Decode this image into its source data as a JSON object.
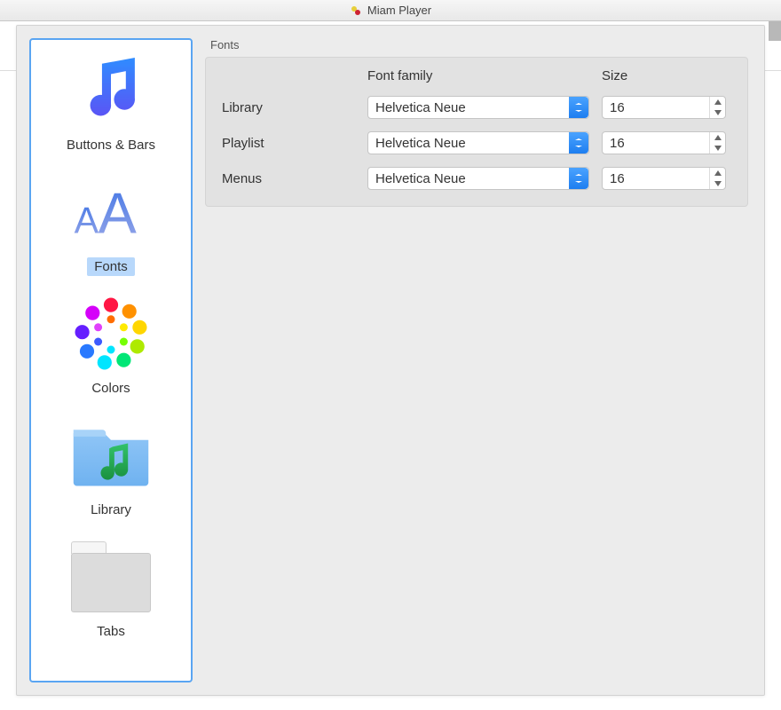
{
  "titlebar": {
    "title": "Miam Player"
  },
  "sidebar": {
    "items": [
      {
        "label": "Buttons & Bars",
        "icon": "music-note-icon"
      },
      {
        "label": "Fonts",
        "icon": "fonts-aa-icon"
      },
      {
        "label": "Colors",
        "icon": "color-wheel-icon"
      },
      {
        "label": "Library",
        "icon": "library-folder-icon"
      },
      {
        "label": "Tabs",
        "icon": "tabs-icon"
      }
    ],
    "selected_index": 1
  },
  "main": {
    "group_title": "Fonts",
    "columns": {
      "font_family": "Font family",
      "size": "Size"
    },
    "rows": [
      {
        "label": "Library",
        "font_family": "Helvetica Neue",
        "size": "16"
      },
      {
        "label": "Playlist",
        "font_family": "Helvetica Neue",
        "size": "16"
      },
      {
        "label": "Menus",
        "font_family": "Helvetica Neue",
        "size": "16"
      }
    ]
  }
}
